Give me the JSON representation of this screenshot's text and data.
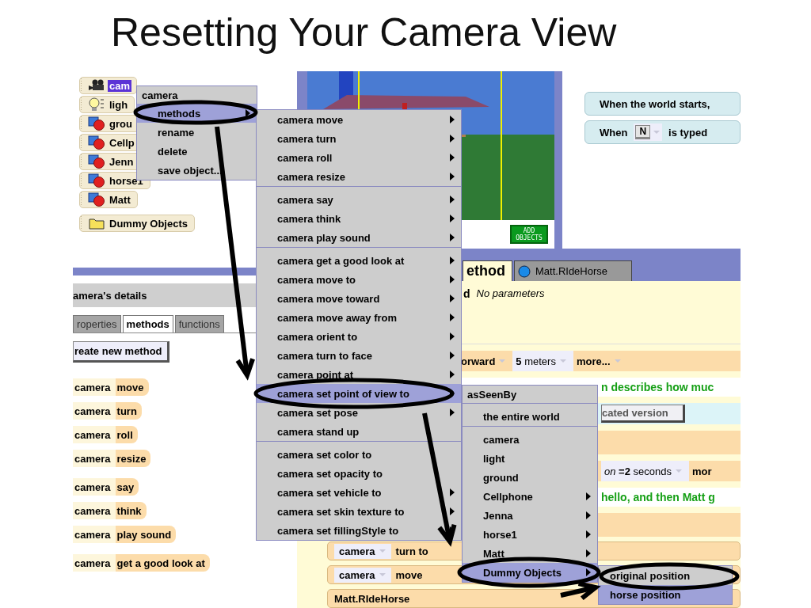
{
  "slide": {
    "title": "Resetting Your Camera View"
  },
  "object_tree": [
    {
      "label": "cam",
      "kind": "camera",
      "selected": true
    },
    {
      "label": "ligh",
      "kind": "light",
      "selected": false
    },
    {
      "label": "grou",
      "kind": "model",
      "selected": false
    },
    {
      "label": "Cellp",
      "kind": "model",
      "selected": false
    },
    {
      "label": "Jenn",
      "kind": "model",
      "selected": false
    },
    {
      "label": "horse1",
      "kind": "model",
      "selected": false
    },
    {
      "label": "Matt",
      "kind": "model",
      "selected": false
    },
    {
      "label": "Dummy Objects",
      "kind": "folder",
      "selected": false
    }
  ],
  "details": {
    "title": "amera's details",
    "tabs": [
      {
        "label": "roperties",
        "selected": false
      },
      {
        "label": "methods",
        "selected": true
      },
      {
        "label": "functions",
        "selected": false
      }
    ],
    "create_button": "reate new method",
    "method_groups": [
      [
        {
          "object": "camera",
          "method": "move"
        },
        {
          "object": "camera",
          "method": "turn"
        },
        {
          "object": "camera",
          "method": "roll"
        },
        {
          "object": "camera",
          "method": "resize"
        }
      ],
      [
        {
          "object": "camera",
          "method": "say"
        },
        {
          "object": "camera",
          "method": "think"
        },
        {
          "object": "camera",
          "method": "play sound"
        }
      ],
      [
        {
          "object": "camera",
          "method": "get a good look at"
        }
      ]
    ]
  },
  "world_view": {
    "add_button": "ADD OBJECTS"
  },
  "events": [
    {
      "kind": "text",
      "text": "When the world starts,"
    },
    {
      "kind": "key",
      "prefix": "When",
      "key": "N",
      "suffix": "is typed"
    }
  ],
  "editor": {
    "tabs": [
      {
        "label": "ethod",
        "icon": false,
        "selected": true
      },
      {
        "label": "Matt.RIdeHorse",
        "icon": true,
        "selected": false
      }
    ],
    "rows": [
      {
        "kind": "header",
        "name": "d",
        "note": "No parameters"
      },
      {
        "kind": "fragment",
        "parts": [
          {
            "text": "orward",
            "dropdown": true,
            "field": false
          },
          {
            "text": "**5** meters",
            "dropdown": true,
            "field": true
          },
          {
            "text": "more...",
            "dropdown": true,
            "field": false
          }
        ]
      },
      {
        "kind": "comment",
        "text": "n describes how muc"
      },
      {
        "kind": "button",
        "text": "cated version"
      },
      {
        "kind": "blank"
      },
      {
        "kind": "fragment",
        "parts": [
          {
            "text": "*on* **=2** seconds",
            "dropdown": true,
            "field": true
          },
          {
            "text": "mor",
            "dropdown": false,
            "field": false
          }
        ]
      },
      {
        "kind": "comment",
        "text": "hello, and then Matt g"
      },
      {
        "kind": "blank"
      },
      {
        "kind": "statement",
        "parts": [
          {
            "text": "camera",
            "dropdown": true,
            "field": true
          },
          {
            "text": "turn to",
            "dropdown": false,
            "field": false
          }
        ]
      },
      {
        "kind": "statement",
        "parts": [
          {
            "text": "camera",
            "dropdown": true,
            "field": true
          },
          {
            "text": "move",
            "dropdown": false,
            "field": false
          }
        ]
      },
      {
        "kind": "statement",
        "parts": [
          {
            "text": "Matt.RIdeHorse",
            "dropdown": false,
            "field": false
          }
        ]
      }
    ]
  },
  "object_menu": {
    "title": "camera",
    "items": [
      {
        "label": "methods",
        "submenu": true,
        "selected": true
      },
      {
        "label": "rename",
        "submenu": false,
        "selected": false
      },
      {
        "label": "delete",
        "submenu": false,
        "selected": false
      },
      {
        "label": "save object...",
        "submenu": false,
        "selected": false
      }
    ]
  },
  "methods_menu": {
    "groups": [
      [
        {
          "label": "camera move",
          "submenu": true,
          "selected": false
        },
        {
          "label": "camera turn",
          "submenu": true,
          "selected": false
        },
        {
          "label": "camera roll",
          "submenu": true,
          "selected": false
        },
        {
          "label": "camera resize",
          "submenu": true,
          "selected": false
        }
      ],
      [
        {
          "label": "camera say",
          "submenu": true,
          "selected": false
        },
        {
          "label": "camera think",
          "submenu": true,
          "selected": false
        },
        {
          "label": "camera play sound",
          "submenu": true,
          "selected": false
        }
      ],
      [
        {
          "label": "camera get a good look at",
          "submenu": true,
          "selected": false
        },
        {
          "label": "camera move to",
          "submenu": true,
          "selected": false
        },
        {
          "label": "camera move  toward",
          "submenu": true,
          "selected": false
        },
        {
          "label": "camera move  away from",
          "submenu": true,
          "selected": false
        },
        {
          "label": "camera orient to",
          "submenu": true,
          "selected": false
        },
        {
          "label": "camera turn to face",
          "submenu": true,
          "selected": false
        },
        {
          "label": "camera point at",
          "submenu": true,
          "selected": false
        },
        {
          "label": "camera set point of view to",
          "submenu": true,
          "selected": true
        },
        {
          "label": "camera set pose",
          "submenu": true,
          "selected": false
        },
        {
          "label": "camera stand up",
          "submenu": false,
          "selected": false
        }
      ],
      [
        {
          "label": "camera set color to",
          "submenu": false,
          "selected": false
        },
        {
          "label": "camera set opacity to",
          "submenu": false,
          "selected": false
        },
        {
          "label": "camera set vehicle to",
          "submenu": true,
          "selected": false
        },
        {
          "label": "camera set skin texture to",
          "submenu": true,
          "selected": false
        },
        {
          "label": "camera set fillingStyle to",
          "submenu": true,
          "selected": false
        }
      ]
    ]
  },
  "as_seen_by_menu": {
    "title": "asSeenBy",
    "groups": [
      [
        {
          "label": "the entire world",
          "submenu": false,
          "selected": false
        }
      ],
      [
        {
          "label": "camera",
          "submenu": false,
          "selected": false
        },
        {
          "label": "light",
          "submenu": false,
          "selected": false
        },
        {
          "label": "ground",
          "submenu": false,
          "selected": false
        },
        {
          "label": "Cellphone",
          "submenu": true,
          "selected": false
        },
        {
          "label": "Jenna",
          "submenu": true,
          "selected": false
        },
        {
          "label": "horse1",
          "submenu": true,
          "selected": false
        },
        {
          "label": "Matt",
          "submenu": true,
          "selected": false
        },
        {
          "label": "Dummy Objects",
          "submenu": true,
          "selected": true
        }
      ]
    ]
  },
  "dummy_menu": {
    "items": [
      {
        "label": "original position",
        "selected": false
      },
      {
        "label": "horse position",
        "selected": true
      }
    ]
  }
}
